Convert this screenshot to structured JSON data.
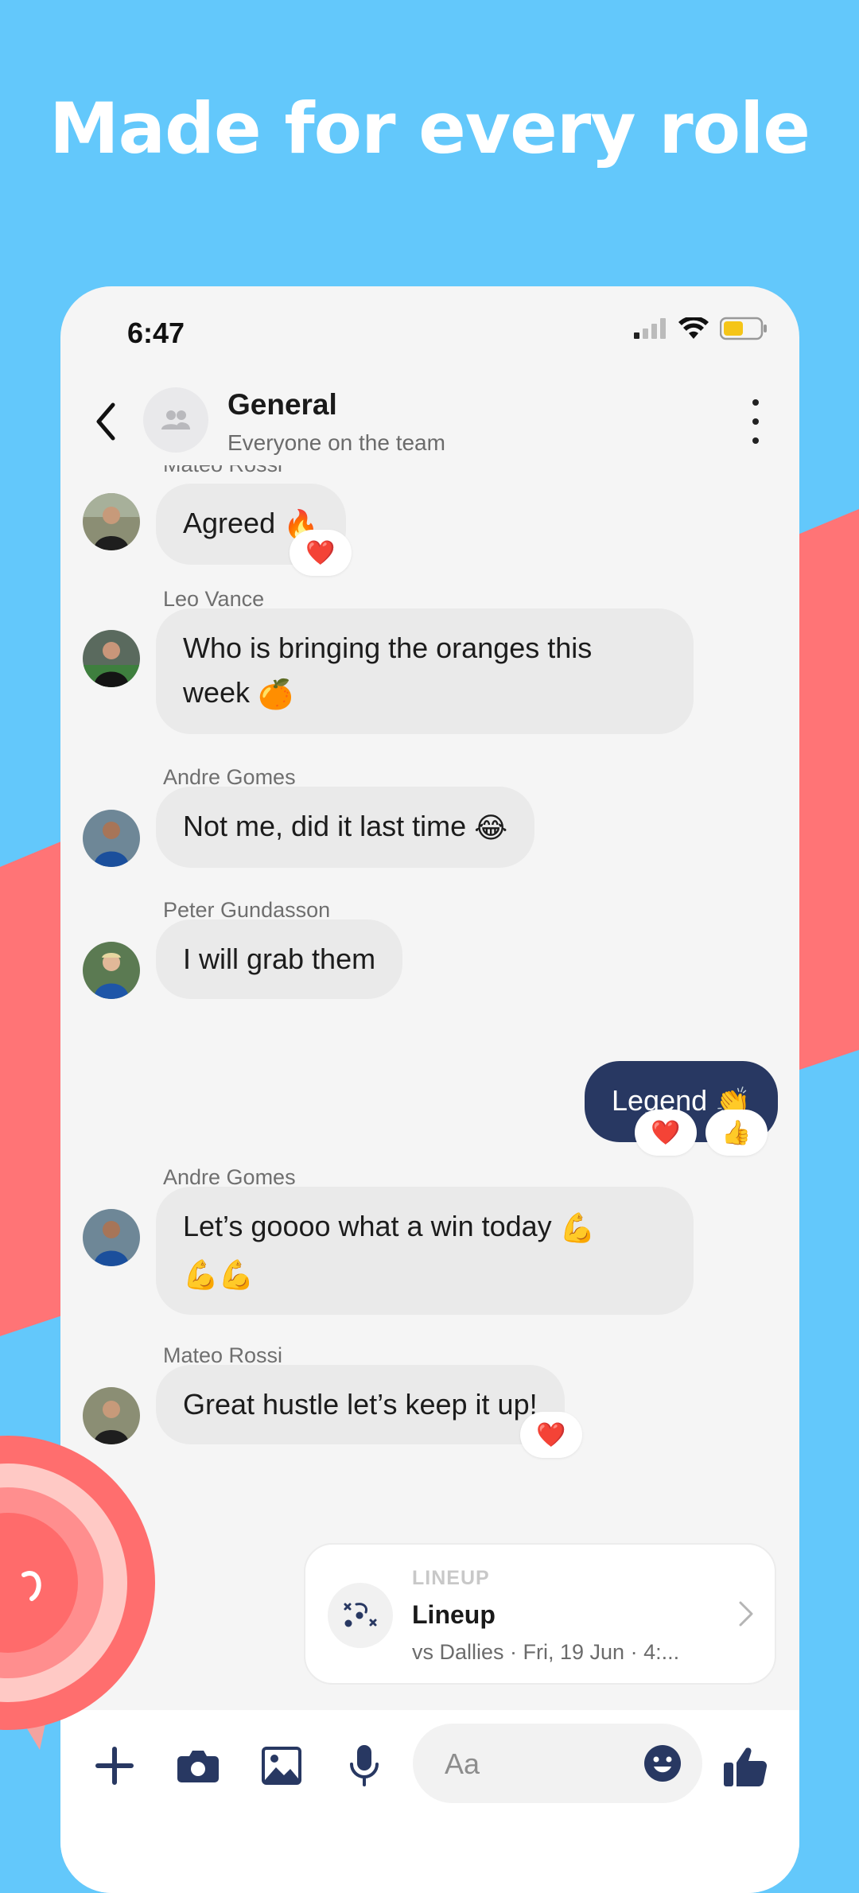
{
  "headline": "Made for every role",
  "status_bar": {
    "time": "6:47"
  },
  "header": {
    "title": "General",
    "subtitle": "Everyone on the team",
    "back_icon": "chevron-left-icon",
    "group_icon": "group-icon",
    "menu_icon": "more-vertical-icon"
  },
  "messages": [
    {
      "sender": "Mateo Rossi",
      "text": "Agreed",
      "emoji": "🔥",
      "reactions": [
        "❤️"
      ]
    },
    {
      "sender": "Leo Vance",
      "line1": "Who is bringing the oranges this",
      "line2": "week",
      "emoji": "🍊",
      "reactions": []
    },
    {
      "sender": "Andre Gomes",
      "text": "Not me, did it last time",
      "emoji": "😂",
      "reactions": []
    },
    {
      "sender": "Peter Gundasson",
      "text": "I will grab them",
      "reactions": []
    },
    {
      "sender": "",
      "text": "Legend",
      "emoji": "👏",
      "mine": true,
      "reactions": [
        "❤️",
        "👍"
      ]
    },
    {
      "sender": "Andre Gomes",
      "line1": "Let’s goooo what a win today",
      "line1_emoji": "💪",
      "line2_emoji": "💪💪",
      "reactions": []
    },
    {
      "sender": "Mateo Rossi",
      "text": "Great hustle let’s keep it up!",
      "reactions": [
        "❤️"
      ]
    }
  ],
  "lineup_card": {
    "kicker": "LINEUP",
    "title": "Lineup",
    "detail": "vs Dallies · Fri, 19 Jun · 4:...",
    "icon": "tactics-icon"
  },
  "composer": {
    "placeholder": "Aa",
    "tools": [
      "plus-icon",
      "camera-icon",
      "image-icon",
      "microphone-icon"
    ],
    "emoji_icon": "smiley-icon",
    "send_icon": "thumbs-up-icon"
  },
  "colors": {
    "background": "#63C8FB",
    "accent_stripe": "#FF7476",
    "my_bubble": "#283862",
    "other_bubble": "#EAEAEA",
    "icon_navy": "#283862"
  }
}
